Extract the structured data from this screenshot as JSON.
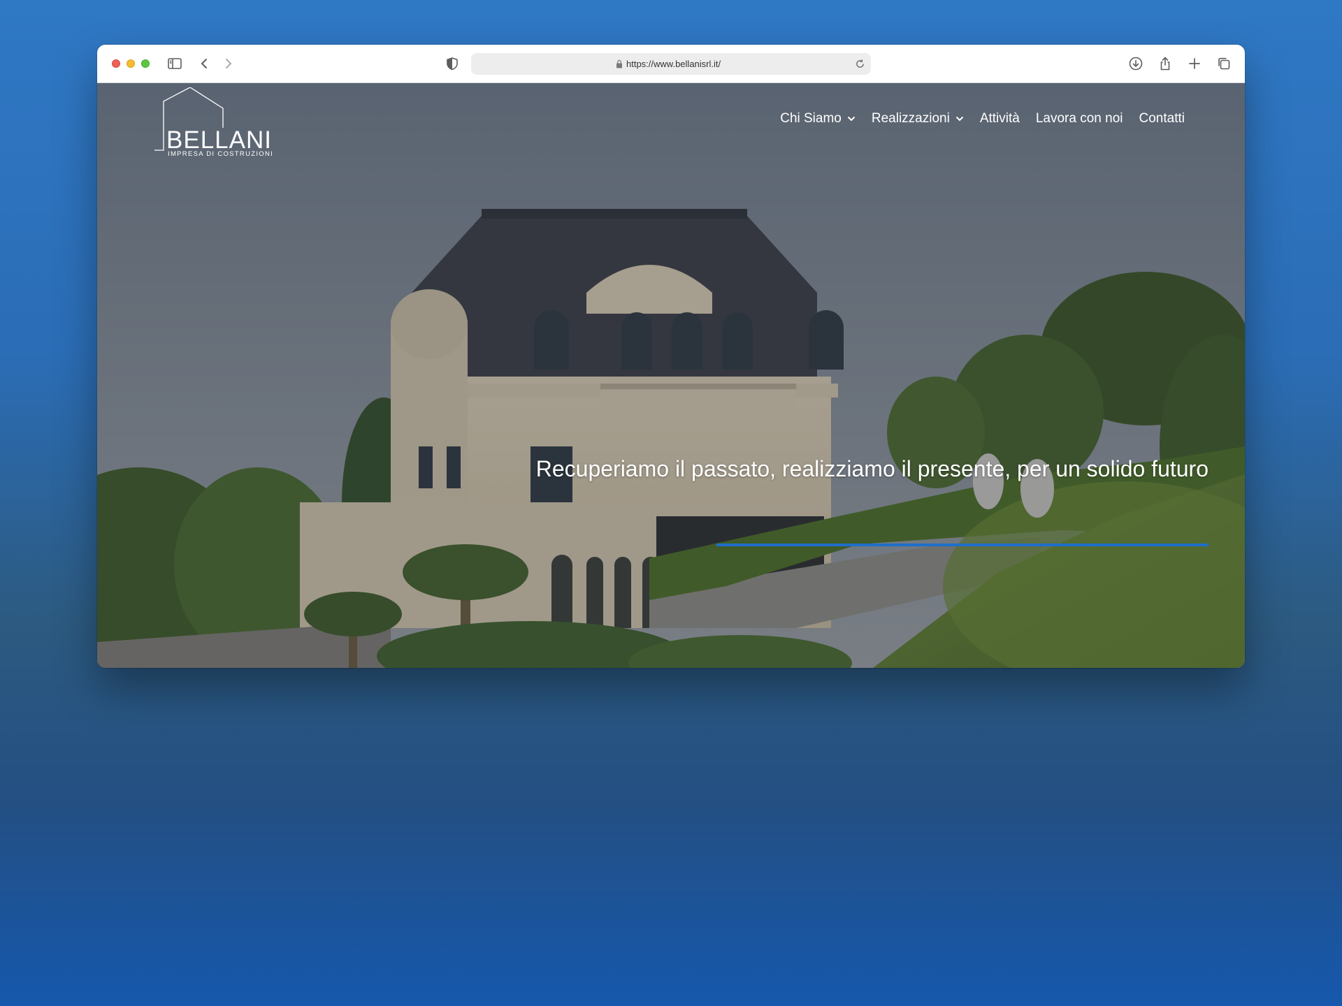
{
  "browser": {
    "url": "https://www.bellanisrl.it/",
    "icons": [
      "sidebar-toggle-icon",
      "back-icon",
      "forward-icon",
      "shield-icon",
      "lock-icon",
      "reload-icon",
      "download-icon",
      "share-icon",
      "new-tab-icon",
      "tab-overview-icon"
    ]
  },
  "site": {
    "logo": {
      "name": "BELLANI",
      "subtitle": "IMPRESA DI COSTRUZIONI"
    },
    "nav": [
      {
        "label": "Chi Siamo",
        "has_dropdown": true
      },
      {
        "label": "Realizzazioni",
        "has_dropdown": true
      },
      {
        "label": "Attività",
        "has_dropdown": false
      },
      {
        "label": "Lavora con noi",
        "has_dropdown": false
      },
      {
        "label": "Contatti",
        "has_dropdown": false
      }
    ],
    "hero": {
      "tagline": "Recuperiamo il passato, realizziamo il presente, per un solido futuro"
    },
    "colors": {
      "accent": "#1f6fc8",
      "text": "#ffffff"
    }
  }
}
